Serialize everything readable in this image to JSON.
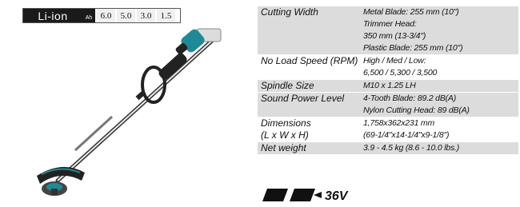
{
  "battery": {
    "chemistry": "Li-ion",
    "unit": "Ah",
    "capacities": [
      "6.0",
      "5.0",
      "3.0",
      "1.5"
    ]
  },
  "badge_text": "36V",
  "specs": [
    {
      "label": "Cutting Width",
      "lines": [
        "Metal Blade: 255 mm (10\")",
        "Trimmer Head:",
        "350 mm (13-3/4\")",
        "Plastic Blade: 255 mm (10\")"
      ]
    },
    {
      "label": "No Load Speed (RPM)",
      "lines": [
        "High / Med / Low:",
        "6,500 / 5,300 / 3,500"
      ]
    },
    {
      "label": "Spindle Size",
      "lines": [
        "M10 x 1.25 LH"
      ]
    },
    {
      "label": "Sound Power Level",
      "lines": [
        "4-Tooth Blade: 89.2 dB(A)",
        "Nylon Cutting Head: 89 dB(A)"
      ]
    },
    {
      "label": "Dimensions",
      "label2": "(L x W x H)",
      "lines": [
        "1,758x362x231 mm",
        "(69-1/4\"x14-1/4\"x9-1/8\")"
      ]
    },
    {
      "label": "Net weight",
      "lines": [
        "3.9 - 4.5 kg (8.6 - 10.0 lbs.)"
      ]
    }
  ],
  "colors": {
    "accent": "#1f8a95",
    "body": "#222222",
    "shade": "#dcdcdc"
  }
}
